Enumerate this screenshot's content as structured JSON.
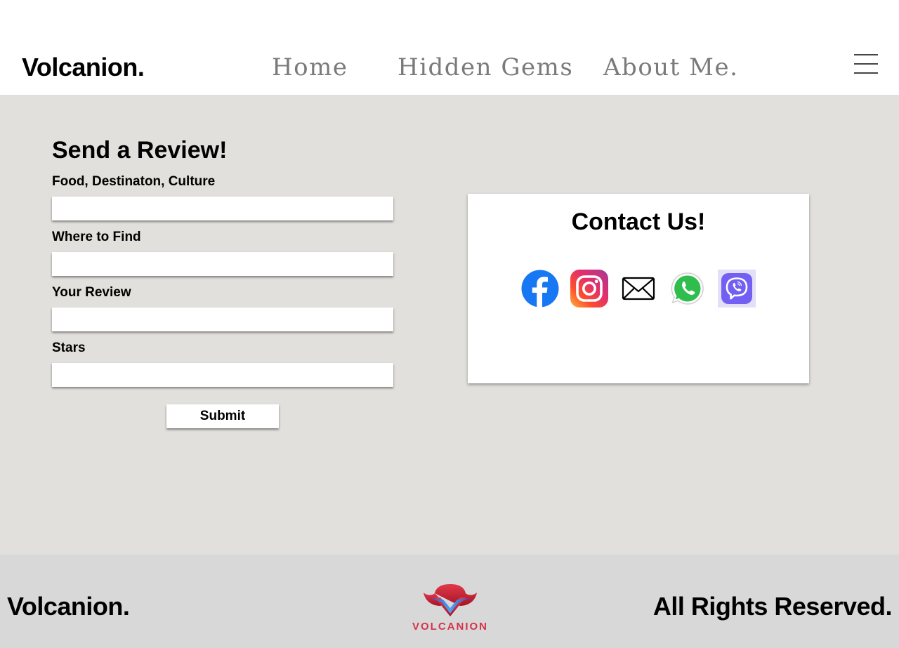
{
  "header": {
    "brand": "Volcanion.",
    "nav": {
      "home": "Home",
      "hidden_gems": "Hidden Gems",
      "about": "About Me."
    },
    "menu_icon": "hamburger-menu-icon"
  },
  "review_form": {
    "title": "Send a Review!",
    "fields": [
      {
        "label": "Food,  Destinaton, Culture",
        "value": ""
      },
      {
        "label": "Where to Find",
        "value": ""
      },
      {
        "label": "Your Review",
        "value": ""
      },
      {
        "label": "Stars",
        "value": ""
      }
    ],
    "submit_label": "Submit"
  },
  "contact": {
    "title": "Contact Us!",
    "icons": [
      "facebook-icon",
      "instagram-icon",
      "email-icon",
      "whatsapp-icon",
      "viber-icon"
    ]
  },
  "footer": {
    "brand": "Volcanion.",
    "logo_text": "VOLCANION",
    "rights": "All Rights Reserved."
  },
  "colors": {
    "main_background": "#e2e0dc",
    "footer_background": "#d8d8d8",
    "nav_text": "#7a7a7a",
    "facebook_blue": "#1877f2",
    "whatsapp_green": "#25d366",
    "viber_purple": "#7360f2"
  }
}
